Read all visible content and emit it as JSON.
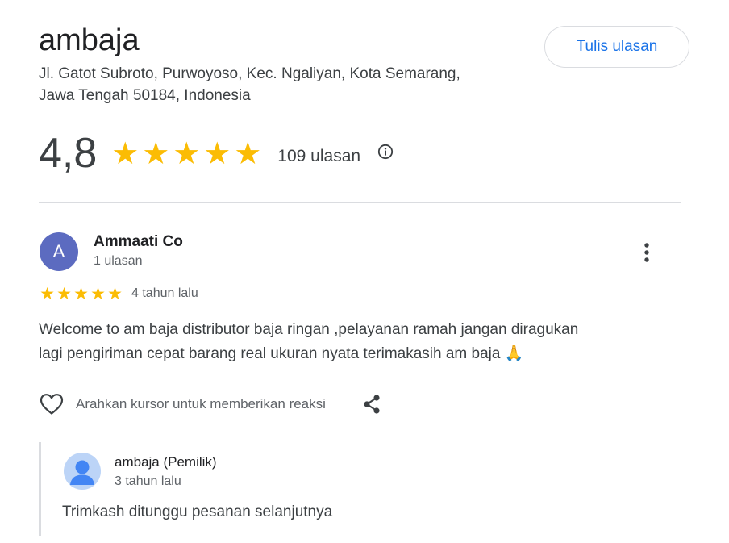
{
  "place": {
    "name": "ambaja",
    "address_line1": "Jl. Gatot Subroto, Purwoyoso, Kec. Ngaliyan, Kota Semarang,",
    "address_line2": "Jawa Tengah 50184, Indonesia"
  },
  "actions": {
    "write_review_label": "Tulis ulasan"
  },
  "summary": {
    "rating": "4,8",
    "stars": [
      "★",
      "★",
      "★",
      "★",
      "★"
    ],
    "review_count": "109 ulasan",
    "info_icon": "info-icon"
  },
  "review": {
    "avatar_letter": "A",
    "avatar_color": "#5c6bc0",
    "reviewer_name": "Ammaati Co",
    "reviewer_meta": "1 ulasan",
    "stars": [
      "★",
      "★",
      "★",
      "★",
      "★"
    ],
    "date": "4 tahun lalu",
    "text_line1": "Welcome to am baja distributor baja ringan ,pelayanan ramah jangan diragukan",
    "text_line2": "lagi pengiriman cepat barang real ukuran nyata terimakasih am baja 🙏",
    "reaction_prompt": "Arahkan kursor untuk memberikan reaksi",
    "more_icon": "more-vert-icon",
    "heart_icon": "heart-outline-icon",
    "share_icon": "share-icon"
  },
  "owner_reply": {
    "name": "ambaja (Pemilik)",
    "date": "3 tahun lalu",
    "text": "Trimkash ditunggu pesanan selanjutnya",
    "avatar_icon": "default-profile-icon"
  },
  "colors": {
    "star": "#fbbc04",
    "link_blue": "#1a73e8",
    "divider": "#dadce0"
  }
}
